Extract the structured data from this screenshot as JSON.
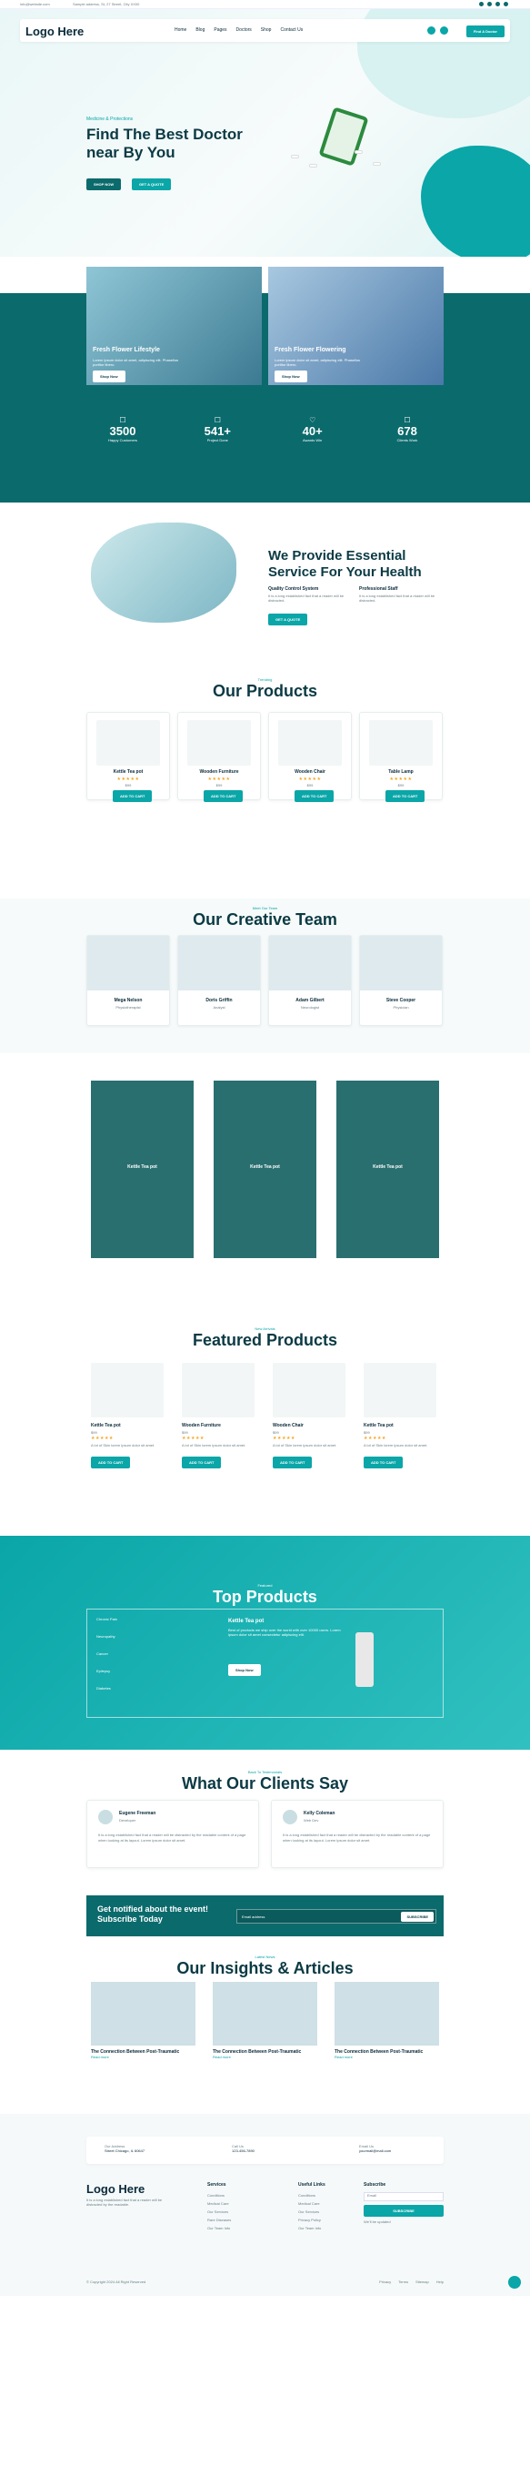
{
  "topbar": {
    "email": "info@website.com",
    "address": "Sample address, St, 27 Street, City XX00"
  },
  "nav": {
    "logo": "Logo Here",
    "items": [
      "Home",
      "Blog",
      "Pages",
      "Doctors",
      "Shop",
      "Contact Us"
    ],
    "cta": "Find A Doctor"
  },
  "hero": {
    "eyebrow": "Medicine & Protections",
    "title_line1": "Find The Best Doctor",
    "title_line2": "near By You",
    "btn1": "SHOP NOW",
    "btn2": "GET A QUOTE"
  },
  "features": [
    {
      "title": "Fresh Flower Lifestyle",
      "text": "Lorem ipsum dolor sit amet, adipiscing elit. Phasellus portitor libero.",
      "btn": "Shop Now"
    },
    {
      "title": "Fresh Flower Flowering",
      "text": "Lorem ipsum dolor sit amet, adipiscing elit. Phasellus portitor libero.",
      "btn": "Shop Now"
    }
  ],
  "stats": [
    {
      "value": "3500",
      "label": "Happy Customers"
    },
    {
      "value": "541+",
      "label": "Project Done"
    },
    {
      "value": "40+",
      "label": "Awards Win"
    },
    {
      "value": "678",
      "label": "Clients Work"
    }
  ],
  "service": {
    "title_line1": "We Provide Essential",
    "title_line2": "Service For Your Health",
    "col1_title": "Quality Control System",
    "col1_text": "It is a long established fact that a reader will be distracted.",
    "col2_title": "Professional Staff",
    "col2_text": "It is a long established fact that a reader will be distracted.",
    "btn": "GET A QUOTE"
  },
  "products": {
    "eyebrow": "Trending",
    "title": "Our Products",
    "items": [
      {
        "name": "Kettle Tea pot",
        "price": "$99",
        "btn": "ADD TO CART"
      },
      {
        "name": "Wooden Furniture",
        "price": "$99",
        "btn": "ADD TO CART"
      },
      {
        "name": "Wooden Chair",
        "price": "$99",
        "btn": "ADD TO CART"
      },
      {
        "name": "Table Lamp",
        "price": "$99",
        "btn": "ADD TO CART"
      }
    ]
  },
  "team": {
    "eyebrow": "Meet Our Team",
    "title": "Our Creative Team",
    "members": [
      {
        "name": "Mega Nelson",
        "role": "Physiotherapist"
      },
      {
        "name": "Doris Griffin",
        "role": "Analyst"
      },
      {
        "name": "Adam Gilbert",
        "role": "Neurologist"
      },
      {
        "name": "Steve Cooper",
        "role": "Physician"
      }
    ]
  },
  "gallery": {
    "items": [
      "Kettle Tea pot",
      "Kettle Tea pot",
      "Kettle Tea pot"
    ]
  },
  "featured": {
    "eyebrow": "New Arrivals",
    "title": "Featured Products",
    "items": [
      {
        "name": "Kettle Tea pot",
        "price": "$99",
        "text": "A lot of Skin lorem ipsum dolor sit amet.",
        "btn": "ADD TO CART"
      },
      {
        "name": "Wooden Furniture",
        "price": "$99",
        "text": "A lot of Skin lorem ipsum dolor sit amet.",
        "btn": "ADD TO CART"
      },
      {
        "name": "Wooden Chair",
        "price": "$99",
        "text": "A lot of Skin lorem ipsum dolor sit amet.",
        "btn": "ADD TO CART"
      },
      {
        "name": "Kettle Tea pot",
        "price": "$99",
        "text": "A lot of Skin lorem ipsum dolor sit amet.",
        "btn": "ADD TO CART"
      }
    ]
  },
  "top": {
    "eyebrow": "Featured",
    "title": "Top Products",
    "tabs": [
      "Chronic Pain",
      "Neuropathy",
      "Cancer",
      "Epilepsy",
      "Diabetes"
    ],
    "prod_title": "Kettle Tea pot",
    "prod_text": "Best of products we ship over the world with over 10000 users. Lorem ipsum dolor sit amet consectetur adipiscing elit.",
    "btn": "Shop Now"
  },
  "testimonials": {
    "eyebrow": "Back To Testimonials",
    "title": "What Our Clients Say",
    "items": [
      {
        "name": "Eugene Freeman",
        "role": "Developer",
        "text": "It is a long established fact that a reader will be distracted by the readable content of a page when looking at its layout. Lorem ipsum dolor sit amet."
      },
      {
        "name": "Kelly Coleman",
        "role": "Web Dev",
        "text": "It is a long established fact that a reader will be distracted by the readable content of a page when looking at its layout. Lorem ipsum dolor sit amet."
      }
    ]
  },
  "newsletter": {
    "title_line1": "Get notified about the event!",
    "title_line2": "Subscribe Today",
    "placeholder": "Email address",
    "btn": "SUBSCRIBE"
  },
  "blog": {
    "eyebrow": "Latest News",
    "title": "Our Insights & Articles",
    "items": [
      {
        "date": "05 JANUARY, 2024",
        "title": "The Connection Between Post-Traumatic",
        "link": "Read more"
      },
      {
        "date": "05 JANUARY, 2024",
        "title": "The Connection Between Post-Traumatic",
        "link": "Read more"
      },
      {
        "date": "05 JANUARY, 2024",
        "title": "The Connection Between Post-Traumatic",
        "link": "Read more"
      }
    ]
  },
  "contact": [
    {
      "label": "Our Address",
      "value": "Street Chicago, IL 60647"
    },
    {
      "label": "Call Us",
      "value": "123-456-7890"
    },
    {
      "label": "Email Us",
      "value": "yourmail@mail.com"
    }
  ],
  "footer": {
    "logo": "Logo Here",
    "about": "It is a long established fact that a reader will be distracted by the readable.",
    "col1_title": "Services",
    "col1": [
      "Conditions",
      "Medical Care",
      "Our Services",
      "Rare Diseases",
      "Our Team Info"
    ],
    "col2_title": "Useful Links",
    "col2": [
      "Conditions",
      "Medical Care",
      "Our Services",
      "Privacy Policy",
      "Our Team Info"
    ],
    "col3_title": "Subscribe",
    "col3_placeholder": "Email",
    "col3_btn": "SUBSCRIBE",
    "col3_text": "We'll be updated",
    "copyright": "© Copyright 2024 All Right Reserved",
    "links": [
      "Privacy",
      "Terms",
      "Sitemap",
      "Help"
    ]
  },
  "colors": {
    "primary": "#0aa6a8",
    "dark": "#0b6a6c",
    "heading": "#0b3a44"
  }
}
